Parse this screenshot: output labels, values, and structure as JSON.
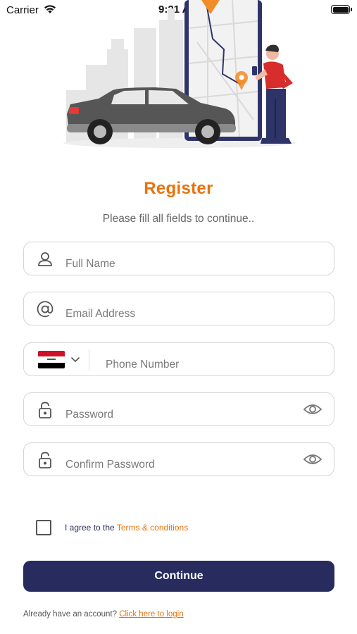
{
  "status_bar": {
    "carrier": "Carrier",
    "time": "9:21 AM"
  },
  "header": {
    "title": "Register",
    "subtitle": "Please fill all fields to continue.."
  },
  "form": {
    "full_name_placeholder": "Full Name",
    "email_placeholder": "Email Address",
    "phone_placeholder": "Phone Number",
    "password_placeholder": "Password",
    "confirm_password_placeholder": "Confirm Password",
    "country_flag": "iraq-flag"
  },
  "agreement": {
    "prefix": "I agree to the ",
    "terms_link": "Terms & conditions",
    "checked": false
  },
  "actions": {
    "continue_label": "Continue",
    "login_prompt": "Already have an account? ",
    "login_link": "Click here to login"
  },
  "colors": {
    "accent": "#e8720c",
    "primary_button": "#272b5e",
    "field_border": "#d5d5d5"
  }
}
